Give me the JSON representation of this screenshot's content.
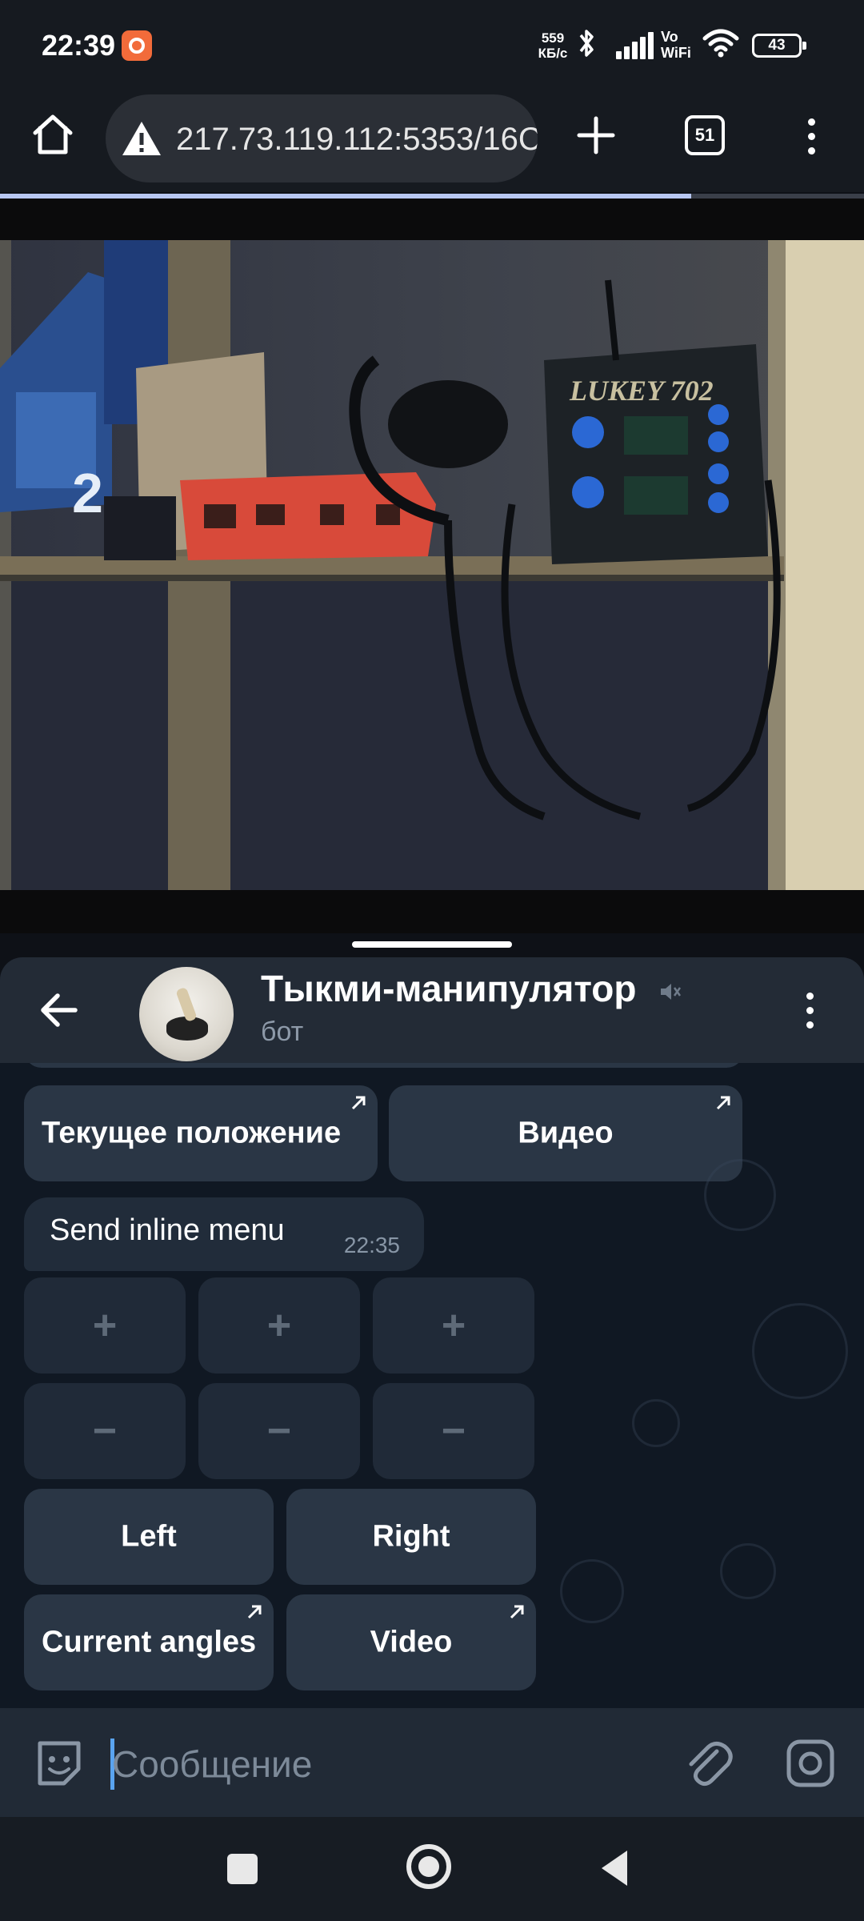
{
  "status_bar": {
    "time": "22:39",
    "net_speed_value": "559",
    "net_speed_unit": "КБ/с",
    "vowifi_top": "Vo",
    "vowifi_bottom": "WiFi",
    "battery": "43"
  },
  "browser": {
    "url": "217.73.119.112:5353/16C",
    "tab_count": "51",
    "load_progress": 0.8
  },
  "chat": {
    "title": "Тыкми-манипулятор",
    "subtitle": "бот",
    "top_keyboard": [
      {
        "label": "Текущее положение",
        "has_arrow": true
      },
      {
        "label": "Видео",
        "has_arrow": true
      }
    ],
    "message": {
      "text": "Send inline menu",
      "time": "22:35"
    },
    "inline_keyboard": {
      "plus_row": [
        "+",
        "+",
        "+"
      ],
      "minus_row": [
        "−",
        "−",
        "−"
      ],
      "direction_row": [
        "Left",
        "Right"
      ],
      "action_row": [
        {
          "label": "Current angles",
          "has_arrow": true
        },
        {
          "label": "Video",
          "has_arrow": true
        }
      ]
    }
  },
  "input": {
    "placeholder": "Сообщение"
  },
  "colors": {
    "accent": "#5aa4f0",
    "button_bg": "#3a485a",
    "chat_bg": "#101823",
    "header_bg": "#232b36"
  }
}
